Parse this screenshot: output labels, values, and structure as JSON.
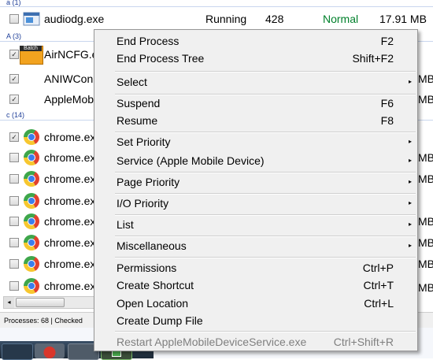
{
  "list": {
    "group_a_lower": "a (1)",
    "group_a_upper": "A (3)",
    "group_c": "c (14)",
    "audiodg": {
      "name": "audiodg.exe",
      "status": "Running",
      "pid": "428",
      "priority": "Normal",
      "memory": "17.91 MB"
    },
    "a_rows": [
      "AirNCFG.e",
      "ANIWCon",
      "AppleMob"
    ],
    "airncfg_badge": "Batch",
    "chrome_rows": [
      "chrome.ex",
      "chrome.ex",
      "chrome.ex",
      "chrome.ex",
      "chrome.ex",
      "chrome.ex",
      "chrome.ex",
      "chrome.ex"
    ],
    "right_mb": "MB",
    "status_text": "Processes: 68  |  Checked"
  },
  "menu": {
    "items": [
      {
        "label": "End Process",
        "shortcut": "F2"
      },
      {
        "label": "End Process Tree",
        "shortcut": "Shift+F2"
      },
      {
        "label": "Select",
        "submenu": true
      },
      {
        "label": "Suspend",
        "shortcut": "F6"
      },
      {
        "label": "Resume",
        "shortcut": "F8"
      },
      {
        "label": "Set Priority",
        "submenu": true
      },
      {
        "label": "Service (Apple Mobile Device)",
        "submenu": true
      },
      {
        "label": "Page Priority",
        "submenu": true
      },
      {
        "label": "I/O  Priority",
        "submenu": true
      },
      {
        "label": "List",
        "submenu": true
      },
      {
        "label": "Miscellaneous",
        "submenu": true
      },
      {
        "label": "Permissions",
        "shortcut": "Ctrl+P"
      },
      {
        "label": "Create Shortcut",
        "shortcut": "Ctrl+T"
      },
      {
        "label": "Open Location",
        "shortcut": "Ctrl+L"
      },
      {
        "label": "Create Dump File"
      },
      {
        "label": "Restart AppleMobileDeviceService.exe",
        "shortcut": "Ctrl+Shift+R",
        "disabled": true
      }
    ],
    "arrow_glyph": "▸"
  },
  "colors": {
    "normal_priority": "#00802b",
    "group_header": "#1f3f99",
    "menu_bg": "#f0f0f0"
  }
}
